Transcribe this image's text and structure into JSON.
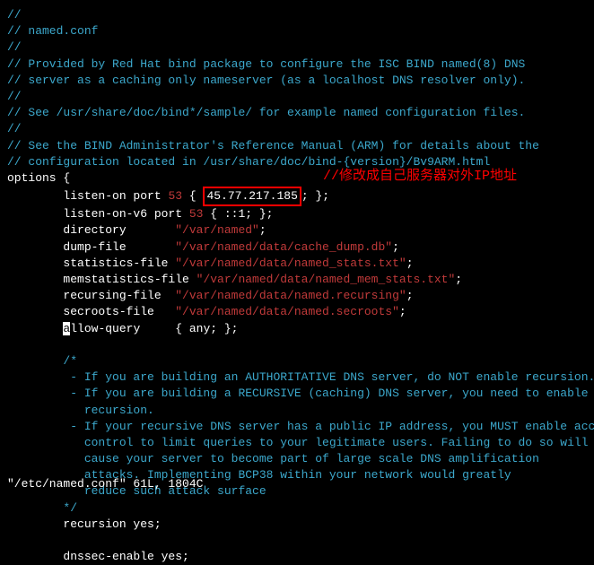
{
  "lines": {
    "l1": "//",
    "l2a": "// named.conf",
    "l3": "//",
    "l4": "// Provided by Red Hat bind package to configure the ISC BIND named(8) DNS",
    "l5": "// server as a caching only nameserver (as a localhost DNS resolver only).",
    "l6": "//",
    "l7": "// See /usr/share/doc/bind*/sample/ for example named configuration files.",
    "l8": "//",
    "l9": "// See the BIND Administrator's Reference Manual (ARM) for details about the",
    "l10": "// configuration located in /usr/share/doc/bind-{version}/Bv9ARM.html",
    "l11": "",
    "options_open": "options {",
    "listen_on_pre": "        listen-on port ",
    "listen_on_port": "53",
    "listen_on_open": " { ",
    "listen_on_ip": "45.77.217.185",
    "listen_on_close": "; };",
    "listen_v6_pre": "        listen-on-v6 port ",
    "listen_v6_port": "53",
    "listen_v6_rest": " { ::1; };",
    "directory_key": "        directory       ",
    "directory_val": "\"/var/named\"",
    "directory_end": ";",
    "dump_key": "        dump-file       ",
    "dump_val": "\"/var/named/data/cache_dump.db\"",
    "dump_end": ";",
    "stats_key": "        statistics-file ",
    "stats_val": "\"/var/named/data/named_stats.txt\"",
    "stats_end": ";",
    "memstats_key": "        memstatistics-file ",
    "memstats_val": "\"/var/named/data/named_mem_stats.txt\"",
    "memstats_end": ";",
    "recurs_key": "        recursing-file  ",
    "recurs_val": "\"/var/named/data/named.recursing\"",
    "recurs_end": ";",
    "secroots_key": "        secroots-file   ",
    "secroots_val": "\"/var/named/data/named.secroots\"",
    "secroots_end": ";",
    "allow_q_a": "a",
    "allow_q_rest": "llow-query     { any; };",
    "cblock_open": "        /*",
    "cblock_1": "         - If you are building an AUTHORITATIVE DNS server, do NOT enable recursion.",
    "cblock_2": "         - If you are building a RECURSIVE (caching) DNS server, you need to enable",
    "cblock_3": "           recursion.",
    "cblock_4": "         - If your recursive DNS server has a public IP address, you MUST enable access",
    "cblock_5": "           control to limit queries to your legitimate users. Failing to do so will",
    "cblock_6": "           cause your server to become part of large scale DNS amplification",
    "cblock_7": "           attacks. Implementing BCP38 within your network would greatly",
    "cblock_8": "           reduce such attack surface",
    "cblock_close": "        */",
    "recursion": "        recursion yes;",
    "dnssec": "        dnssec-enable yes;"
  },
  "annotation": "//修改成自己服务器对外IP地址",
  "status": "\"/etc/named.conf\" 61L, 1804C"
}
